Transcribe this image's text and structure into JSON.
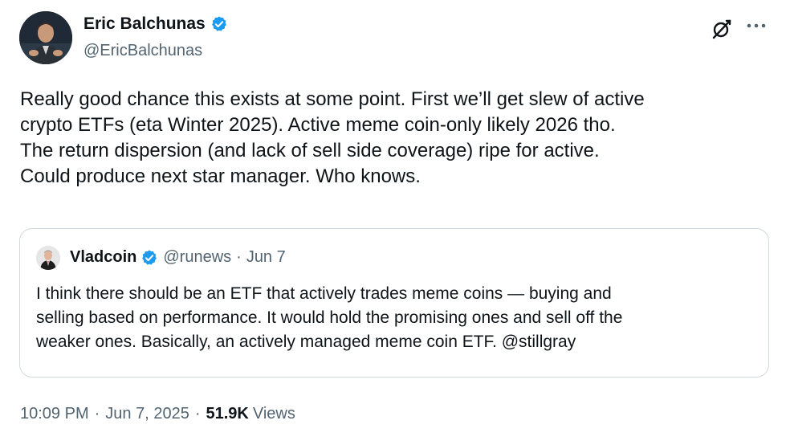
{
  "author": {
    "display_name": "Eric Balchunas",
    "handle": "@EricBalchunas",
    "verified_color": "#1d9bf0"
  },
  "icons": {
    "grok": "grok-icon",
    "more": "more-icon",
    "verified": "verified-badge-icon"
  },
  "tweet_lines": [
    "Really good chance this exists at some point. First we’ll get slew of active",
    "crypto ETFs (eta Winter 2025). Active meme coin-only likely 2026 tho.",
    "The return dispersion (and lack of sell side coverage) ripe for active.",
    "Could produce next star manager. Who knows."
  ],
  "quote": {
    "display_name": "Vladcoin",
    "handle": "@runews",
    "separator": "·",
    "date": "Jun 7",
    "lines": [
      "I think there should be an ETF that actively trades meme coins — buying and",
      "selling based on performance. It would hold the promising ones and sell off the",
      "weaker ones. Basically, an actively managed meme coin ETF. @stillgray"
    ]
  },
  "meta": {
    "time": "10:09 PM",
    "separator": "·",
    "date": "Jun 7, 2025",
    "views_count": "51.9K",
    "views_label": "Views"
  },
  "colors": {
    "text": "#0f1419",
    "secondary": "#536471",
    "border": "#cfd9de",
    "accent": "#1d9bf0"
  }
}
